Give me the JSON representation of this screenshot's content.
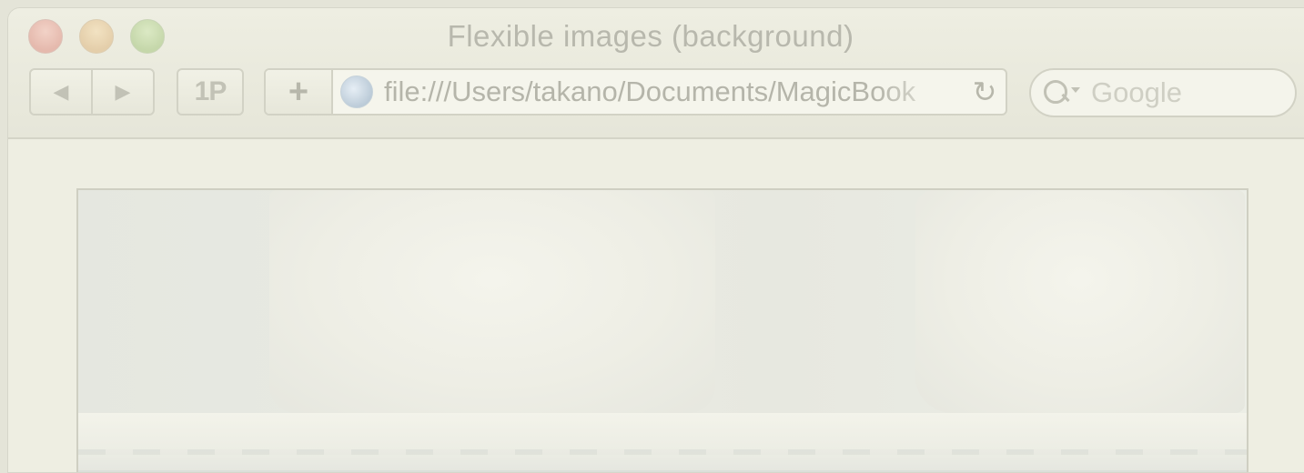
{
  "window": {
    "title": "Flexible images (background)"
  },
  "toolbar": {
    "back_glyph": "◀",
    "forward_glyph": "▶",
    "onepassword_label": "1P",
    "add_bookmark_glyph": "+",
    "url": "file:///Users/takano/Documents/MagicBook",
    "reload_glyph": "↻",
    "search_placeholder": "Google"
  },
  "icons": {
    "back": "back-arrow-icon",
    "forward": "forward-arrow-icon",
    "globe": "globe-icon",
    "reload": "reload-icon",
    "search": "magnifier-icon"
  },
  "colors": {
    "window_bg": "#ececdf",
    "close": "#e5b9ad",
    "minimize": "#e4ceaa",
    "zoom": "#c5d7aa"
  }
}
